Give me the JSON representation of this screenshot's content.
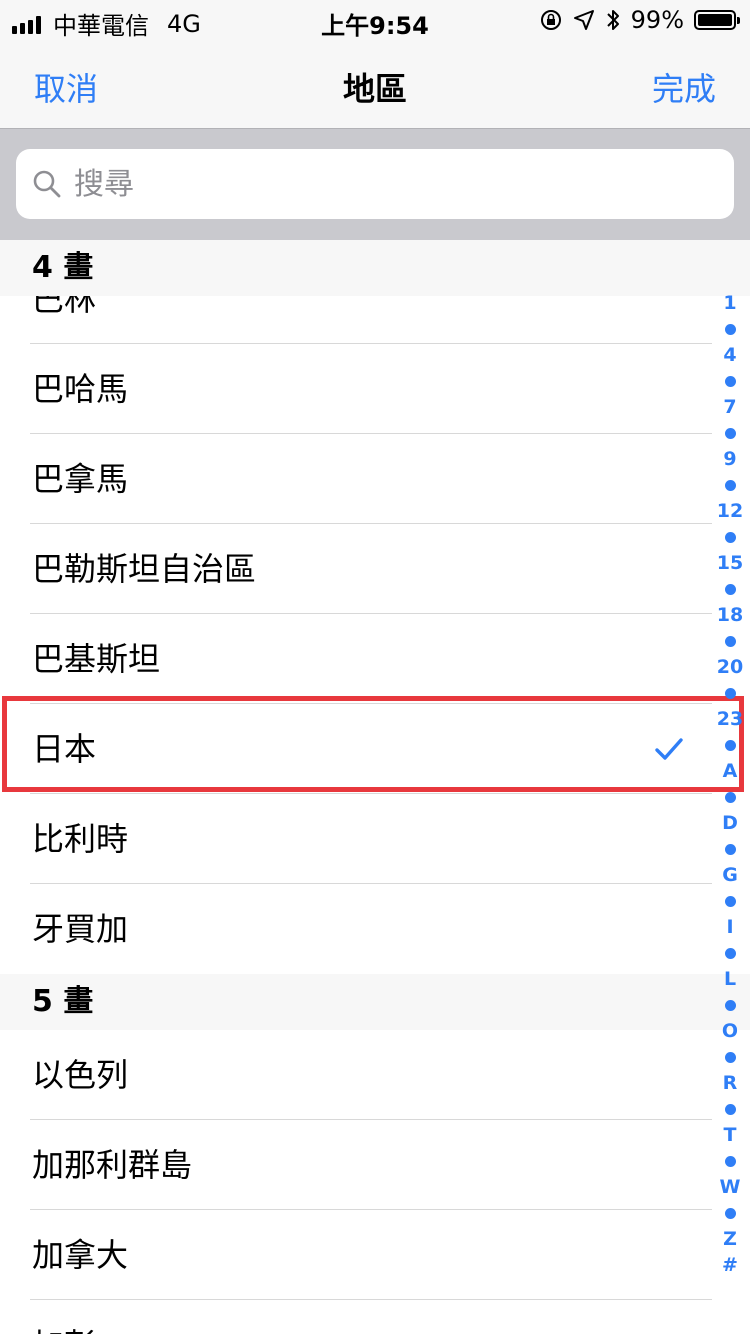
{
  "status_bar": {
    "carrier": "中華電信",
    "network": "4G",
    "time": "上午9:54",
    "battery": "99%",
    "battery_level": 0.99
  },
  "nav": {
    "cancel": "取消",
    "title": "地區",
    "done": "完成"
  },
  "search": {
    "placeholder": "搜尋"
  },
  "sections": [
    {
      "header": "4 畫",
      "items": [
        "巴林",
        "巴哈馬",
        "巴拿馬",
        "巴勒斯坦自治區",
        "巴基斯坦",
        "日本",
        "比利時",
        "牙買加"
      ]
    },
    {
      "header": "5 畫",
      "items": [
        "以色列",
        "加那利群島",
        "加拿大",
        "加彭"
      ]
    }
  ],
  "selected_region": "日本",
  "index": [
    "1",
    "4",
    "7",
    "9",
    "12",
    "15",
    "18",
    "20",
    "23",
    "A",
    "D",
    "G",
    "I",
    "L",
    "O",
    "R",
    "T",
    "W",
    "Z",
    "#"
  ],
  "colors": {
    "accent": "#2f7ef6",
    "highlight": "#e8383d"
  }
}
